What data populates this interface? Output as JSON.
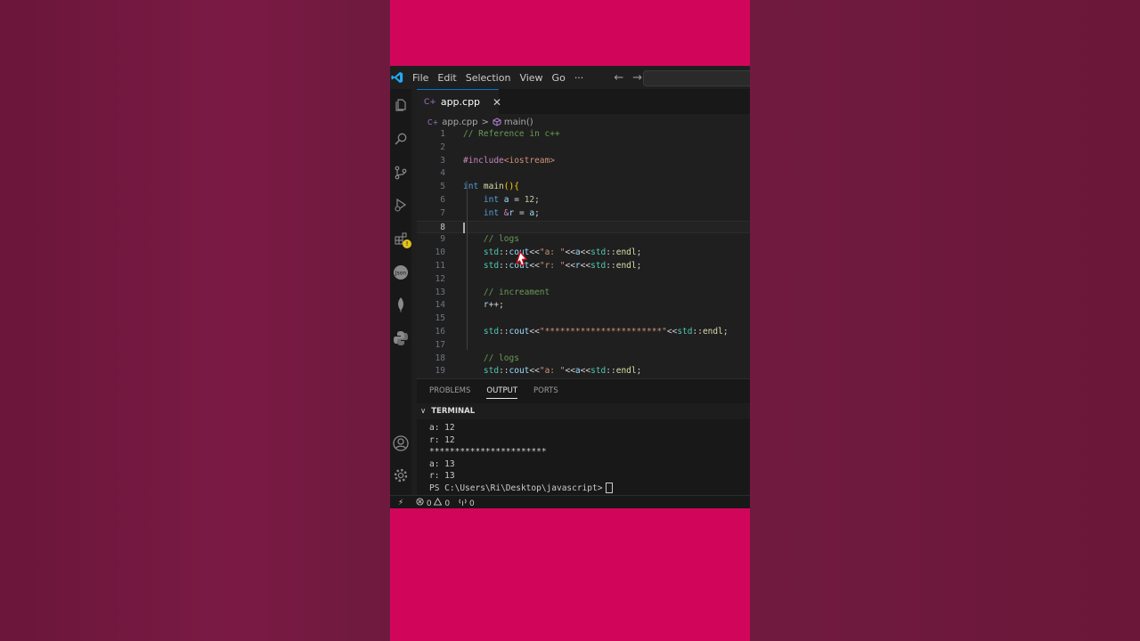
{
  "menu": [
    "File",
    "Edit",
    "Selection",
    "View",
    "Go",
    "···"
  ],
  "nav": {
    "back": "←",
    "forward": "→"
  },
  "tab": {
    "file": "app.cpp",
    "icon": "C+",
    "close": "✕"
  },
  "breadcrumb": {
    "file": "app.cpp",
    "separator": ">",
    "symbol": "main()"
  },
  "code_lines": [
    {
      "n": "1",
      "tokens": [
        {
          "t": "// Reference in c++",
          "c": "com"
        }
      ]
    },
    {
      "n": "2",
      "tokens": []
    },
    {
      "n": "3",
      "tokens": [
        {
          "t": "#include",
          "c": "pre"
        },
        {
          "t": "<iostream>",
          "c": "str"
        }
      ]
    },
    {
      "n": "4",
      "tokens": []
    },
    {
      "n": "5",
      "tokens": [
        {
          "t": "int ",
          "c": "kw"
        },
        {
          "t": "main",
          "c": "fn"
        },
        {
          "t": "(){",
          "c": "br"
        }
      ]
    },
    {
      "n": "6",
      "tokens": [
        {
          "t": "    "
        },
        {
          "t": "int ",
          "c": "kw"
        },
        {
          "t": "a",
          "c": "var"
        },
        {
          "t": " = "
        },
        {
          "t": "12",
          "c": "num"
        },
        {
          "t": ";"
        }
      ]
    },
    {
      "n": "7",
      "tokens": [
        {
          "t": "    "
        },
        {
          "t": "int ",
          "c": "kw"
        },
        {
          "t": "&",
          "c": "pre"
        },
        {
          "t": "r",
          "c": "var"
        },
        {
          "t": " = "
        },
        {
          "t": "a",
          "c": "var"
        },
        {
          "t": ";"
        }
      ]
    },
    {
      "n": "8",
      "tokens": [],
      "active": true
    },
    {
      "n": "9",
      "tokens": [
        {
          "t": "    "
        },
        {
          "t": "// logs",
          "c": "com"
        }
      ]
    },
    {
      "n": "10",
      "tokens": [
        {
          "t": "    "
        },
        {
          "t": "std",
          "c": "ns"
        },
        {
          "t": "::"
        },
        {
          "t": "cout",
          "c": "var"
        },
        {
          "t": "<<"
        },
        {
          "t": "\"a: \"",
          "c": "str"
        },
        {
          "t": "<<"
        },
        {
          "t": "a",
          "c": "var"
        },
        {
          "t": "<<"
        },
        {
          "t": "std",
          "c": "ns"
        },
        {
          "t": "::"
        },
        {
          "t": "endl",
          "c": "fn"
        },
        {
          "t": ";"
        }
      ]
    },
    {
      "n": "11",
      "tokens": [
        {
          "t": "    "
        },
        {
          "t": "std",
          "c": "ns"
        },
        {
          "t": "::"
        },
        {
          "t": "cout",
          "c": "var"
        },
        {
          "t": "<<"
        },
        {
          "t": "\"r: \"",
          "c": "str"
        },
        {
          "t": "<<"
        },
        {
          "t": "r",
          "c": "var"
        },
        {
          "t": "<<"
        },
        {
          "t": "std",
          "c": "ns"
        },
        {
          "t": "::"
        },
        {
          "t": "endl",
          "c": "fn"
        },
        {
          "t": ";"
        }
      ]
    },
    {
      "n": "12",
      "tokens": []
    },
    {
      "n": "13",
      "tokens": [
        {
          "t": "    "
        },
        {
          "t": "// increament",
          "c": "com"
        }
      ]
    },
    {
      "n": "14",
      "tokens": [
        {
          "t": "    "
        },
        {
          "t": "r",
          "c": "var"
        },
        {
          "t": "++;"
        }
      ]
    },
    {
      "n": "15",
      "tokens": []
    },
    {
      "n": "16",
      "tokens": [
        {
          "t": "    "
        },
        {
          "t": "std",
          "c": "ns"
        },
        {
          "t": "::"
        },
        {
          "t": "cout",
          "c": "var"
        },
        {
          "t": "<<"
        },
        {
          "t": "\"***********************\"",
          "c": "str"
        },
        {
          "t": "<<"
        },
        {
          "t": "std",
          "c": "ns"
        },
        {
          "t": "::"
        },
        {
          "t": "endl",
          "c": "fn"
        },
        {
          "t": ";"
        }
      ]
    },
    {
      "n": "17",
      "tokens": []
    },
    {
      "n": "18",
      "tokens": [
        {
          "t": "    "
        },
        {
          "t": "// logs",
          "c": "com"
        }
      ]
    },
    {
      "n": "19",
      "tokens": [
        {
          "t": "    "
        },
        {
          "t": "std",
          "c": "ns"
        },
        {
          "t": "::"
        },
        {
          "t": "cout",
          "c": "var"
        },
        {
          "t": "<<"
        },
        {
          "t": "\"a: \"",
          "c": "str"
        },
        {
          "t": "<<"
        },
        {
          "t": "a",
          "c": "var"
        },
        {
          "t": "<<"
        },
        {
          "t": "std",
          "c": "ns"
        },
        {
          "t": "::"
        },
        {
          "t": "endl",
          "c": "fn"
        },
        {
          "t": ";"
        }
      ]
    }
  ],
  "panel": {
    "tabs": [
      "PROBLEMS",
      "OUTPUT",
      "PORTS"
    ],
    "active_tab": "OUTPUT",
    "terminal_label": "TERMINAL",
    "chevron": "∨"
  },
  "terminal_lines": [
    "a: 12",
    "r: 12",
    "***********************",
    "a: 13",
    "r: 13"
  ],
  "terminal_prompt": "PS C:\\Users\\Ri\\Desktop\\javascript>",
  "status": {
    "errors": "0",
    "warnings": "0",
    "ports": "0",
    "remote": "⚡"
  },
  "colors": {
    "accent": "#0078d4",
    "background": "#1f1f1f",
    "page_pink": "#d1065a"
  },
  "icons": [
    "explorer-icon",
    "search-icon",
    "source-control-icon",
    "run-debug-icon",
    "extensions-icon",
    "json-icon",
    "mongodb-leaf-icon",
    "python-icon",
    "account-icon",
    "settings-gear-icon"
  ]
}
